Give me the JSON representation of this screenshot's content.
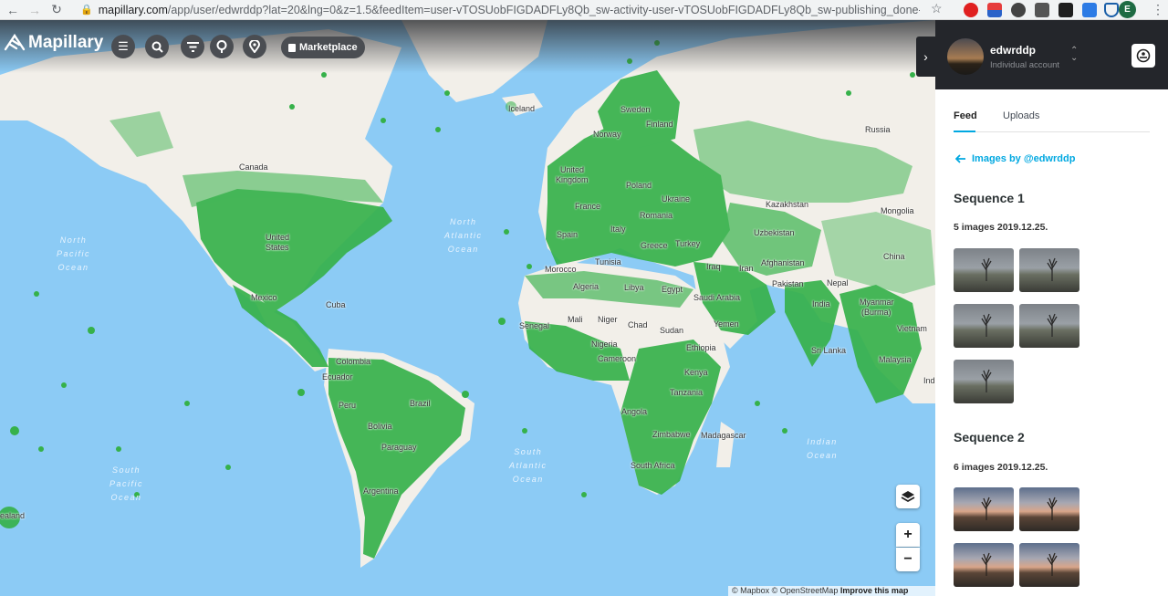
{
  "browser": {
    "url_host": "mapillary.com",
    "url_rest": "/app/user/edwrddp?lat=20&lng=0&z=1.5&feedItem=user-vTOSUobFIGDADFLy8Qb_sw-activity-user-vTOSUobFIGDADFLy8Qb_sw-publishing_done-image",
    "profile_initial": "E"
  },
  "map": {
    "logo": "Mapillary",
    "marketplace_label": "Marketplace",
    "zoom_in": "+",
    "zoom_out": "−",
    "attribution": "© Mapbox © OpenStreetMap",
    "attribution_link": "Improve this map",
    "land_color": "#f2efe9",
    "coverage_color": "#36b14a",
    "water_color": "#8ccbf5",
    "labels": {
      "iceland": "Iceland",
      "sweden": "Sweden",
      "finland": "Finland",
      "norway": "Norway",
      "russia": "Russia",
      "uk1": "United",
      "uk2": "Kingdom",
      "poland": "Poland",
      "ukraine": "Ukraine",
      "france": "France",
      "romania": "Romania",
      "kazakhstan": "Kazakhstan",
      "mongolia": "Mongolia",
      "spain": "Spain",
      "italy": "Italy",
      "greece": "Greece",
      "turkey": "Turkey",
      "uzbekistan": "Uzbekistan",
      "canada": "Canada",
      "us1": "United",
      "us2": "States",
      "morocco": "Morocco",
      "tunisia": "Tunisia",
      "algeria": "Algeria",
      "libya": "Libya",
      "egypt": "Egypt",
      "iraq": "Iraq",
      "iran": "Iran",
      "afghanistan": "Afghanistan",
      "china": "China",
      "saudi": "Saudi Arabia",
      "pakistan": "Pakistan",
      "nepal": "Nepal",
      "mexico": "Mexico",
      "cuba": "Cuba",
      "india": "India",
      "myanmar1": "Myanmar",
      "myanmar2": "(Burma)",
      "senegal": "Senegal",
      "mali": "Mali",
      "niger": "Niger",
      "chad": "Chad",
      "sudan": "Sudan",
      "yemen": "Yemen",
      "vietnam": "Vietnam",
      "nigeria": "Nigeria",
      "ethiopia": "Ethiopia",
      "srilanka": "Sri Lanka",
      "colombia": "Colombia",
      "cameroon": "Cameroon",
      "ecuador": "Ecuador",
      "kenya": "Kenya",
      "malaysia": "Malaysia",
      "peru": "Peru",
      "brazil": "Brazil",
      "tanzania": "Tanzania",
      "angola": "Angola",
      "bolivia": "Bolivia",
      "zimbabwe": "Zimbabwe",
      "madagascar": "Madagascar",
      "paraguay": "Paraguay",
      "southafrica": "South Africa",
      "argentina": "Argentina",
      "zealand": "ealand",
      "indo": "Ind"
    },
    "oceans": {
      "north_pacific": "North\nPacific\nOcean",
      "north_atlantic": "North\nAtlantic\nOcean",
      "south_pacific": "South\nPacific\nOcean",
      "south_atlantic": "South\nAtlantic\nOcean",
      "indian": "Indian\nOcean"
    }
  },
  "panel": {
    "username": "edwrddp",
    "account_type": "Individual account",
    "tabs": [
      "Feed",
      "Uploads"
    ],
    "back_link": "Images by @edwrddp",
    "sequences": [
      {
        "title": "Sequence 1",
        "subtitle": "5 images 2019.12.25."
      },
      {
        "title": "Sequence 2",
        "subtitle": "6 images 2019.12.25."
      }
    ]
  }
}
